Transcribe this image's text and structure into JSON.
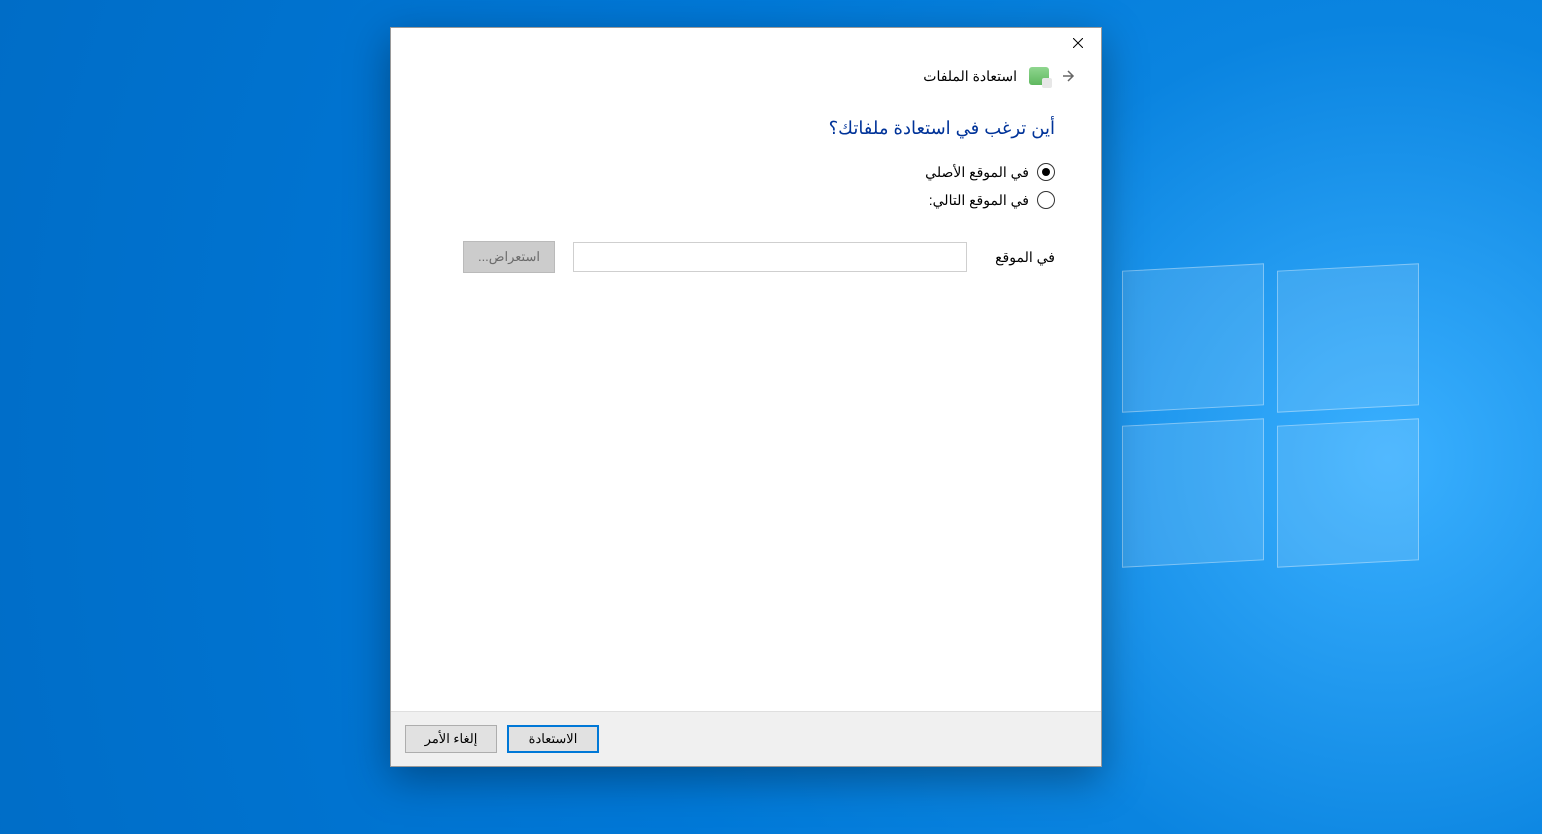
{
  "header": {
    "title": "استعادة الملفات"
  },
  "main": {
    "heading": "أين ترغب في استعادة ملفاتك؟",
    "option_original": "في الموقع الأصلي",
    "option_following": "في الموقع التالي:",
    "location_label": "في الموقع",
    "location_value": "",
    "browse_label": "استعراض..."
  },
  "footer": {
    "restore_label": "الاستعادة",
    "cancel_label": "إلغاء الأمر"
  }
}
